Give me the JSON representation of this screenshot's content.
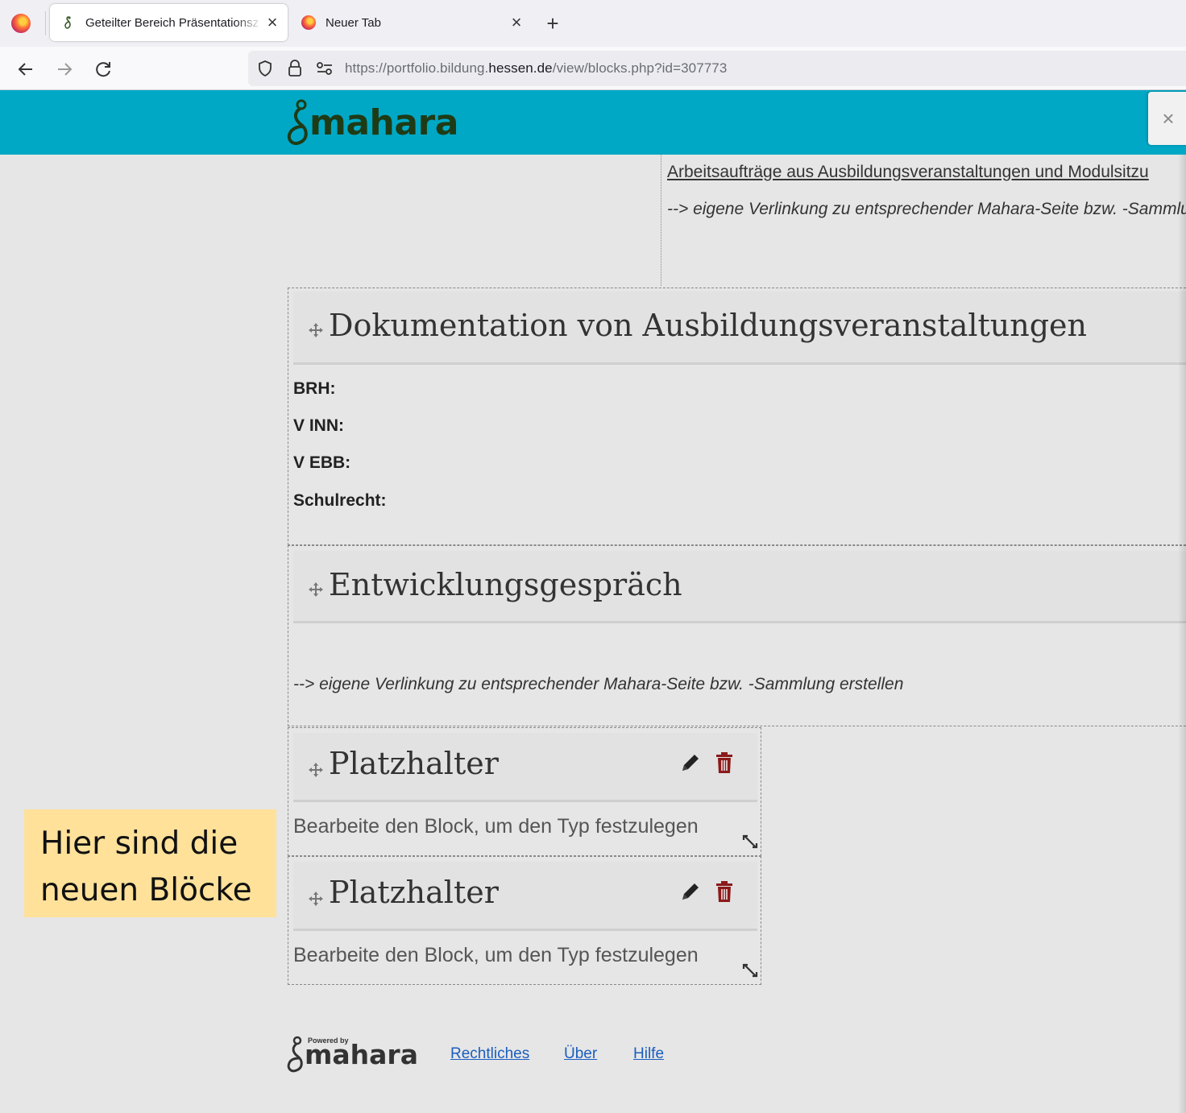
{
  "browser": {
    "tabs": [
      {
        "title": "Geteilter Bereich Präsentationsz",
        "active": true
      },
      {
        "title": "Neuer Tab",
        "active": false
      }
    ],
    "url": {
      "prefix": "https://portfolio.bildung.",
      "domain": "hessen.de",
      "path": "/view/blocks.php?id=307773"
    }
  },
  "header": {
    "logo_text": "mahara",
    "close_glyph": "×",
    "color": "#00a8c6"
  },
  "top_block": {
    "link": "Arbeitsaufträge aus Ausbildungsveranstaltungen und Modulsitzu",
    "note": "--> eigene Verlinkung zu entsprechender Mahara-Seite bzw. -Sammlu"
  },
  "blocks": {
    "dokumentation": {
      "title": "Dokumentation von Ausbildungsveranstaltungen",
      "fields": [
        "BRH:",
        "V INN:",
        "V EBB:",
        "Schulrecht:"
      ]
    },
    "entwicklung": {
      "title": "Entwicklungsgespräch",
      "note": "--> eigene Verlinkung zu entsprechender Mahara-Seite bzw. -Sammlung erstellen"
    },
    "placeholders": [
      {
        "title": "Platzhalter",
        "text": "Bearbeite den Block, um den Typ festzulegen"
      },
      {
        "title": "Platzhalter",
        "text": "Bearbeite den Block, um den Typ festzulegen"
      }
    ]
  },
  "annotation": {
    "line1": "Hier sind die",
    "line2": "neuen Blöcke",
    "color": "#ffe19a"
  },
  "footer": {
    "powered_by": "Powered by",
    "logo_text": "mahara",
    "links": [
      "Rechtliches",
      "Über",
      "Hilfe"
    ]
  }
}
